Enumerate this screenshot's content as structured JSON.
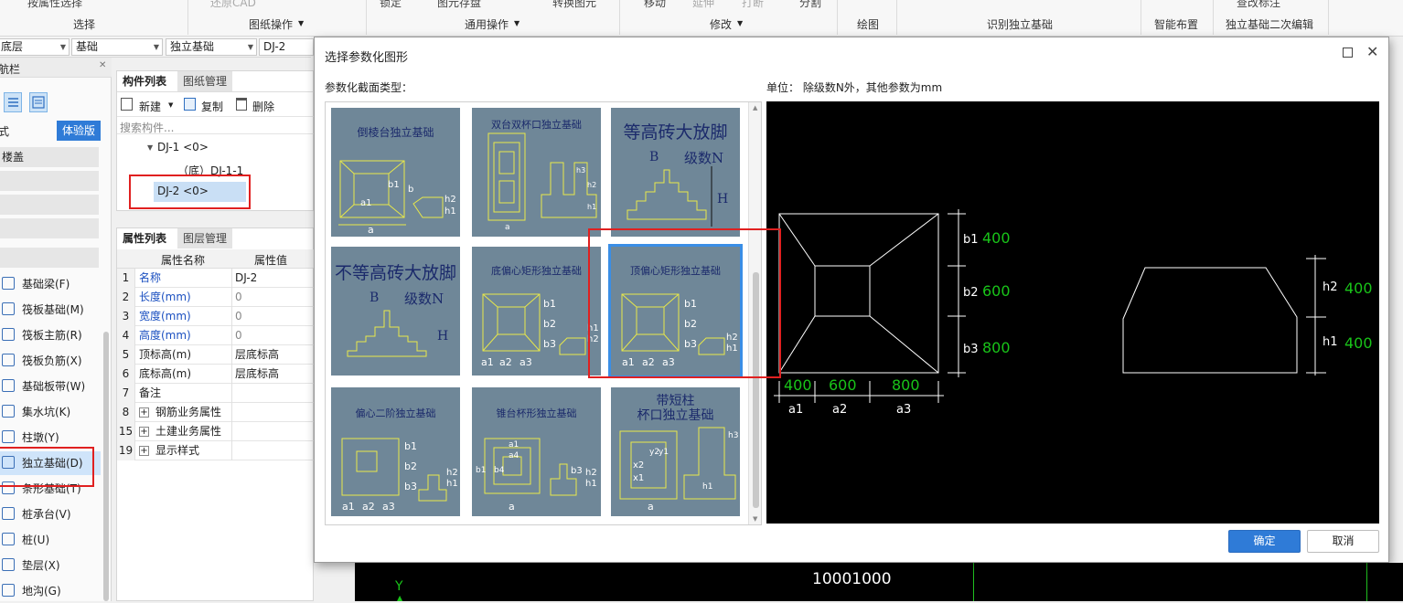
{
  "ribbon": {
    "top_items": {
      "select_by_attr": "按属性选择",
      "restore_cad": "还原CAD",
      "lock": "锁定",
      "save_graphic": "图元存盘",
      "convert_graphic": "转换图元",
      "move": "移动",
      "extend": "延伸",
      "break": "打断",
      "split": "分割",
      "view_annot": "查改标注"
    },
    "groups": {
      "select": "选择",
      "drawing_ops": "图纸操作",
      "common_ops": "通用操作",
      "modify": "修改",
      "draw": "绘图",
      "identify": "识别独立基础",
      "smart_layout": "智能布置",
      "secondary_edit": "独立基础二次编辑"
    }
  },
  "filterbar": {
    "layer": "底层",
    "category": "基础",
    "type": "独立基础",
    "item": "DJ-2"
  },
  "leftnav": {
    "title": "航栏",
    "mode_label": "式",
    "trial_badge": "体验版",
    "group_header": "楼盖",
    "items": [
      {
        "label": "基础梁(F)",
        "icon": "foundation-beam-icon"
      },
      {
        "label": "筏板基础(M)",
        "icon": "raft-foundation-icon"
      },
      {
        "label": "筏板主筋(R)",
        "icon": "raft-main-rebar-icon"
      },
      {
        "label": "筏板负筋(X)",
        "icon": "raft-negative-rebar-icon"
      },
      {
        "label": "基础板带(W)",
        "icon": "foundation-strip-icon"
      },
      {
        "label": "集水坑(K)",
        "icon": "sump-pit-icon"
      },
      {
        "label": "柱墩(Y)",
        "icon": "column-pier-icon"
      },
      {
        "label": "独立基础(D)",
        "icon": "isolated-foundation-icon"
      },
      {
        "label": "条形基础(T)",
        "icon": "strip-foundation-icon"
      },
      {
        "label": "桩承台(V)",
        "icon": "pile-cap-icon"
      },
      {
        "label": "桩(U)",
        "icon": "pile-icon"
      },
      {
        "label": "垫层(X)",
        "icon": "cushion-layer-icon"
      },
      {
        "label": "地沟(G)",
        "icon": "trench-icon"
      }
    ]
  },
  "component_panel": {
    "tabs": [
      "构件列表",
      "图纸管理"
    ],
    "toolbar": {
      "new": "新建",
      "copy": "复制",
      "delete": "删除"
    },
    "search_placeholder": "搜索构件...",
    "tree": [
      {
        "label": "DJ-1 <0>"
      },
      {
        "label": "（底）DJ-1-1"
      },
      {
        "label": "DJ-2 <0>"
      }
    ]
  },
  "property_panel": {
    "tabs": [
      "属性列表",
      "图层管理"
    ],
    "headers": [
      "属性名称",
      "属性值"
    ],
    "rows": [
      {
        "num": "1",
        "name": "名称",
        "value": "DJ-2"
      },
      {
        "num": "2",
        "name": "长度(mm)",
        "value": "0"
      },
      {
        "num": "3",
        "name": "宽度(mm)",
        "value": "0"
      },
      {
        "num": "4",
        "name": "高度(mm)",
        "value": "0"
      },
      {
        "num": "5",
        "name": "顶标高(m)",
        "value": "层底标高"
      },
      {
        "num": "6",
        "name": "底标高(m)",
        "value": "层底标高"
      },
      {
        "num": "7",
        "name": "备注",
        "value": ""
      },
      {
        "num": "8",
        "name": "钢筋业务属性",
        "value": ""
      },
      {
        "num": "15",
        "name": "土建业务属性",
        "value": ""
      },
      {
        "num": "19",
        "name": "显示样式",
        "value": ""
      }
    ]
  },
  "dialog": {
    "title": "选择参数化图形",
    "section_label": "参数化截面类型：",
    "unit_label": "单位：  除级数N外，其他参数为mm",
    "ok": "确定",
    "cancel": "取消",
    "shapes": [
      {
        "title": "倒棱台独立基础"
      },
      {
        "title": "双台双杯口独立基础"
      },
      {
        "title": "等高砖大放脚"
      },
      {
        "title": "不等高砖大放脚"
      },
      {
        "title": "底偏心矩形独立基础"
      },
      {
        "title": "顶偏心矩形独立基础"
      },
      {
        "title": "偏心二阶独立基础"
      },
      {
        "title": "锥台杯形独立基础"
      },
      {
        "title": "带短柱杯口独立基础",
        "title_line1": "带短柱",
        "title_line2": "杯口独立基础"
      }
    ],
    "thumb_labels": {
      "a": "a",
      "a1": "a1",
      "a2": "a2",
      "a3": "a3",
      "b": "b",
      "b1": "b1",
      "b2": "b2",
      "b3": "b3",
      "h1": "h1",
      "h2": "h2",
      "h3": "h3",
      "H": "H",
      "B": "B",
      "N": "级数N",
      "x1": "x1",
      "x2": "x2",
      "y1": "y1",
      "y2": "y2",
      "a4": "a4",
      "b4": "b4"
    },
    "preview": {
      "b1": {
        "label": "b1",
        "value": "400"
      },
      "b2": {
        "label": "b2",
        "value": "600"
      },
      "b3": {
        "label": "b3",
        "value": "800"
      },
      "a1": {
        "label": "a1",
        "value": "400"
      },
      "a2": {
        "label": "a2",
        "value": "600"
      },
      "a3": {
        "label": "a3",
        "value": "800"
      },
      "h2": {
        "label": "h2",
        "value": "400"
      },
      "h1": {
        "label": "h1",
        "value": "400"
      }
    }
  },
  "canvas": {
    "axis_y": "Y",
    "dimension": "10001000"
  },
  "colors": {
    "accent": "#2f7bd7",
    "highlight_red": "#e02020",
    "cad_green": "#19c419",
    "thumb_bg": "#6f8798",
    "thumb_line": "#e8e84a"
  }
}
